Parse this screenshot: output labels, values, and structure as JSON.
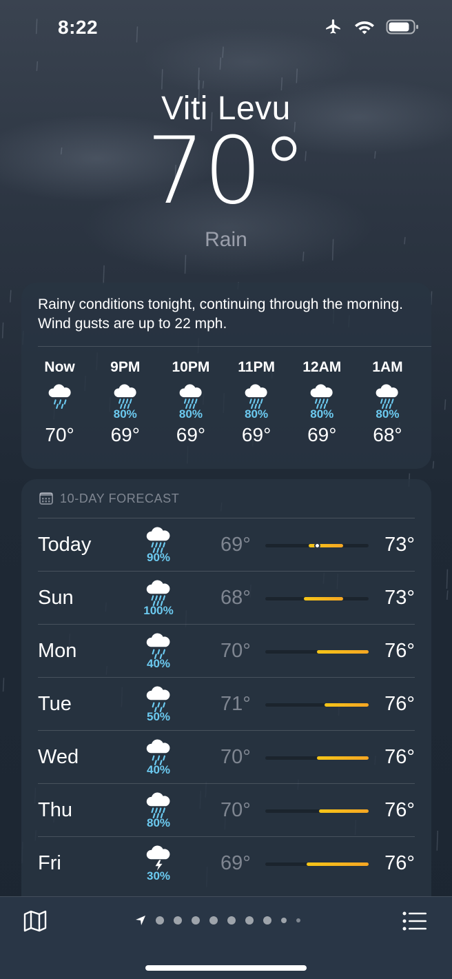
{
  "status": {
    "time": "8:22"
  },
  "location": {
    "city": "Viti Levu",
    "temperature": "70°",
    "condition": "Rain"
  },
  "summary": "Rainy conditions tonight, continuing through the morning. Wind gusts are up to 22 mph.",
  "hourly": [
    {
      "label": "Now",
      "precip": "",
      "temp": "70°",
      "icon": "cloud-rain-icon"
    },
    {
      "label": "9PM",
      "precip": "80%",
      "temp": "69°",
      "icon": "cloud-heavy-rain-icon"
    },
    {
      "label": "10PM",
      "precip": "80%",
      "temp": "69°",
      "icon": "cloud-heavy-rain-icon"
    },
    {
      "label": "11PM",
      "precip": "80%",
      "temp": "69°",
      "icon": "cloud-heavy-rain-icon"
    },
    {
      "label": "12AM",
      "precip": "80%",
      "temp": "69°",
      "icon": "cloud-heavy-rain-icon"
    },
    {
      "label": "1AM",
      "precip": "80%",
      "temp": "68°",
      "icon": "cloud-heavy-rain-icon"
    }
  ],
  "forecast": {
    "heading": "10-DAY FORECAST",
    "days": [
      {
        "day": "Today",
        "precip": "90%",
        "low": "69°",
        "high": "73°",
        "icon": "cloud-heavy-rain-icon",
        "bar_start": 0.42,
        "bar_end": 0.75,
        "current": 0.5
      },
      {
        "day": "Sun",
        "precip": "100%",
        "low": "68°",
        "high": "73°",
        "icon": "cloud-heavy-rain-icon",
        "bar_start": 0.37,
        "bar_end": 0.75
      },
      {
        "day": "Mon",
        "precip": "40%",
        "low": "70°",
        "high": "76°",
        "icon": "cloud-rain-icon",
        "bar_start": 0.5,
        "bar_end": 1.0
      },
      {
        "day": "Tue",
        "precip": "50%",
        "low": "71°",
        "high": "76°",
        "icon": "cloud-rain-icon",
        "bar_start": 0.57,
        "bar_end": 1.0
      },
      {
        "day": "Wed",
        "precip": "40%",
        "low": "70°",
        "high": "76°",
        "icon": "cloud-rain-icon",
        "bar_start": 0.5,
        "bar_end": 1.0
      },
      {
        "day": "Thu",
        "precip": "80%",
        "low": "70°",
        "high": "76°",
        "icon": "cloud-heavy-rain-icon",
        "bar_start": 0.52,
        "bar_end": 1.0
      },
      {
        "day": "Fri",
        "precip": "30%",
        "low": "69°",
        "high": "76°",
        "icon": "cloud-bolt-icon",
        "bar_start": 0.4,
        "bar_end": 1.0
      }
    ]
  },
  "colors": {
    "precip": "#6ccaf0",
    "bar": "#f5c518",
    "background": "#1f2935"
  }
}
